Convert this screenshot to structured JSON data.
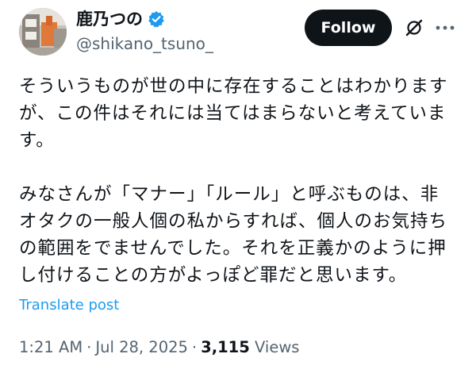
{
  "author": {
    "display_name": "鹿乃つの",
    "handle": "@shikano_tsuno_",
    "verified": true,
    "verified_color": "#1d9bf0"
  },
  "actions": {
    "follow_label": "Follow",
    "follow_bg": "#0f1419",
    "icons": [
      "grok-icon",
      "more-icon"
    ]
  },
  "post": {
    "paragraphs": [
      "そういうものが世の中に存在することはわかります\nが、この件はそれには当てはまらないと考えていま\nす。",
      "みなさんが「マナー」「ルール」と呼ぶものは、非\nオタクの一般人個の私からすれば、個人のお気持ち\nの範囲をでませんでした。それを正義かのように押\nし付けることの方がよっぽど罪だと思います。"
    ],
    "translate_label": "Translate post",
    "link_color": "#1d9bf0"
  },
  "meta": {
    "time": "1:21 AM",
    "separator": "·",
    "date": "Jul 28, 2025",
    "views_count": "3,115",
    "views_label": "Views"
  }
}
